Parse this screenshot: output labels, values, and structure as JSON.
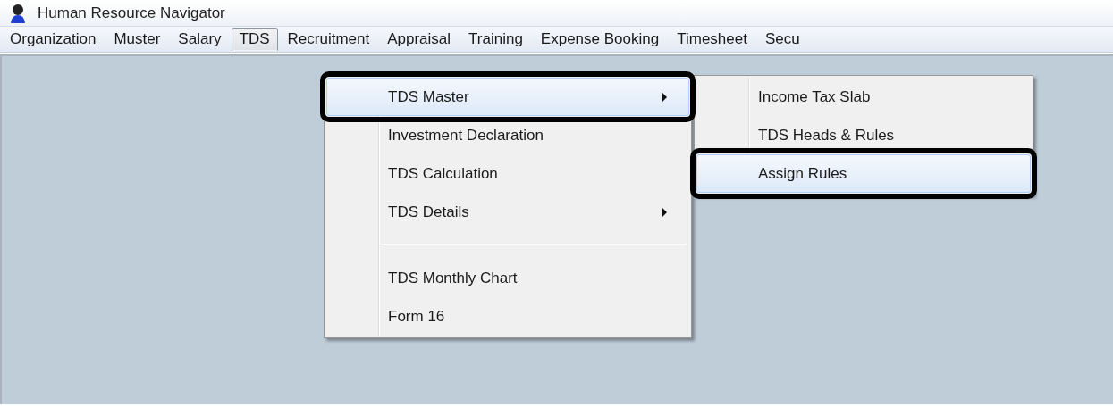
{
  "window": {
    "title": "Human Resource Navigator"
  },
  "menu_bar": [
    {
      "label": "Organization",
      "selected": false
    },
    {
      "label": "Muster",
      "selected": false
    },
    {
      "label": "Salary",
      "selected": false
    },
    {
      "label": "TDS",
      "selected": true
    },
    {
      "label": "Recruitment",
      "selected": false
    },
    {
      "label": "Appraisal",
      "selected": false
    },
    {
      "label": "Training",
      "selected": false
    },
    {
      "label": "Expense Booking",
      "selected": false
    },
    {
      "label": "Timesheet",
      "selected": false
    },
    {
      "label": "Secu",
      "selected": false
    }
  ],
  "tds_menu": {
    "items": [
      {
        "kind": "item",
        "label": "TDS Master",
        "submenu": true,
        "selected": true
      },
      {
        "kind": "item",
        "label": "Investment Declaration",
        "submenu": false,
        "selected": false
      },
      {
        "kind": "item",
        "label": "TDS Calculation",
        "submenu": false,
        "selected": false
      },
      {
        "kind": "item",
        "label": "TDS Details",
        "submenu": true,
        "selected": false
      },
      {
        "kind": "separator"
      },
      {
        "kind": "item",
        "label": "TDS Monthly Chart",
        "submenu": false,
        "selected": false
      },
      {
        "kind": "item",
        "label": "Form 16",
        "submenu": false,
        "selected": false
      }
    ]
  },
  "tds_master_submenu": {
    "items": [
      {
        "kind": "item",
        "label": "Income Tax Slab",
        "submenu": false,
        "selected": false
      },
      {
        "kind": "item",
        "label": "TDS Heads & Rules",
        "submenu": false,
        "selected": false
      },
      {
        "kind": "item",
        "label": "Assign Rules",
        "submenu": false,
        "selected": true
      }
    ]
  }
}
